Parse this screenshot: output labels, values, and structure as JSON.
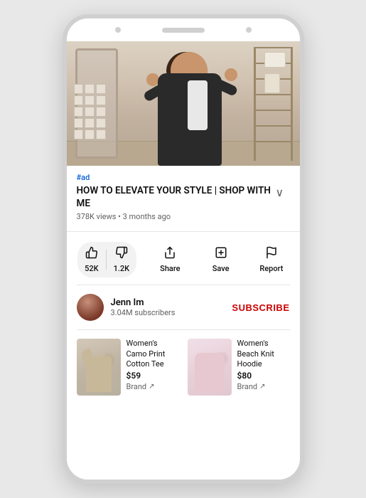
{
  "phone": {
    "ad_tag": "#ad",
    "video_title": "HOW TO ELEVATE YOUR STYLE | SHOP WITH ME",
    "video_meta": "378K views • 3 months ago",
    "chevron": "∨",
    "actions": {
      "like": {
        "label": "52K",
        "icon": "👍"
      },
      "dislike": {
        "label": "1.2K",
        "icon": "👎"
      },
      "share": {
        "label": "Share",
        "icon": "share"
      },
      "save": {
        "label": "Save",
        "icon": "save"
      },
      "report": {
        "label": "Report",
        "icon": "flag"
      }
    },
    "channel": {
      "name": "Jenn Im",
      "subscribers": "3.04M subscribers",
      "subscribe_label": "SUBSCRIBE"
    },
    "products": [
      {
        "name": "Women's Camo Print Cotton Tee",
        "price": "$59",
        "brand": "Brand"
      },
      {
        "name": "Women's Beach Knit Hoodie",
        "price": "$80",
        "brand": "Brand"
      }
    ]
  }
}
